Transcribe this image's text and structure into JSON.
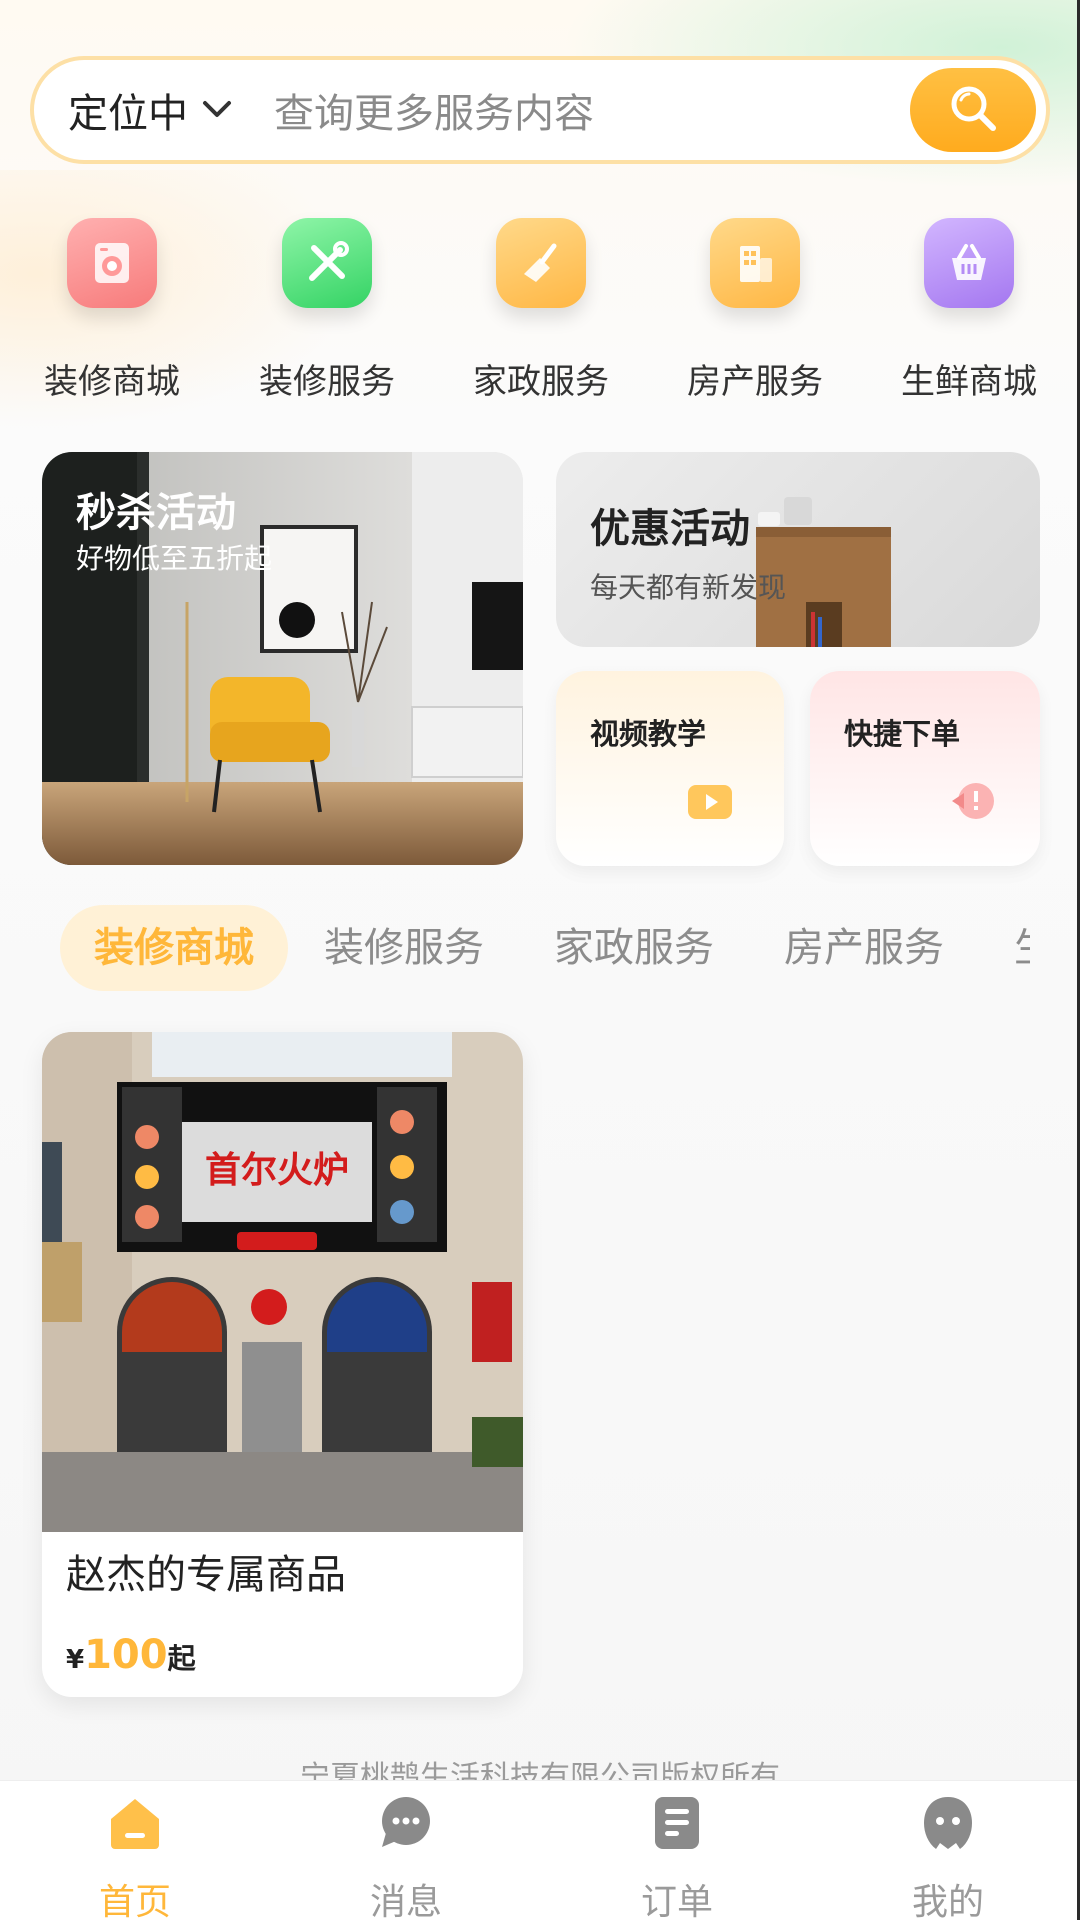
{
  "search": {
    "location_label": "定位中",
    "placeholder": "查询更多服务内容"
  },
  "categories": [
    {
      "label": "装修商城",
      "icon": "washing-machine-icon",
      "color": "#fb8a8a"
    },
    {
      "label": "装修服务",
      "icon": "tools-icon",
      "color": "#58e07e"
    },
    {
      "label": "家政服务",
      "icon": "broom-icon",
      "color": "#ffc25a"
    },
    {
      "label": "房产服务",
      "icon": "building-icon",
      "color": "#ffc25a"
    },
    {
      "label": "生鲜商城",
      "icon": "basket-icon",
      "color": "#b48cf5"
    }
  ],
  "promos": {
    "flash_sale": {
      "title": "秒杀活动",
      "subtitle": "好物低至五折起"
    },
    "discount": {
      "title": "优惠活动",
      "subtitle": "每天都有新发现"
    },
    "video_tutorial": {
      "title": "视频教学"
    },
    "quick_order": {
      "title": "快捷下单"
    }
  },
  "tabs": [
    {
      "label": "装修商城",
      "active": true
    },
    {
      "label": "装修服务",
      "active": false
    },
    {
      "label": "家政服务",
      "active": false
    },
    {
      "label": "房产服务",
      "active": false
    },
    {
      "label": "生",
      "active": false
    }
  ],
  "product": {
    "name": "赵杰的专属商品",
    "currency": "¥",
    "price": "100",
    "price_suffix": "起",
    "sign_text": "首尔火炉"
  },
  "footer": {
    "copyright": "宁夏桃鹊生活科技有限公司版权所有"
  },
  "nav": [
    {
      "label": "首页",
      "icon": "home-icon",
      "active": true
    },
    {
      "label": "消息",
      "icon": "chat-icon",
      "active": false
    },
    {
      "label": "订单",
      "icon": "order-icon",
      "active": false
    },
    {
      "label": "我的",
      "icon": "profile-icon",
      "active": false
    }
  ],
  "colors": {
    "accent": "#ffb73a",
    "accent_bg": "#fff1d6"
  }
}
